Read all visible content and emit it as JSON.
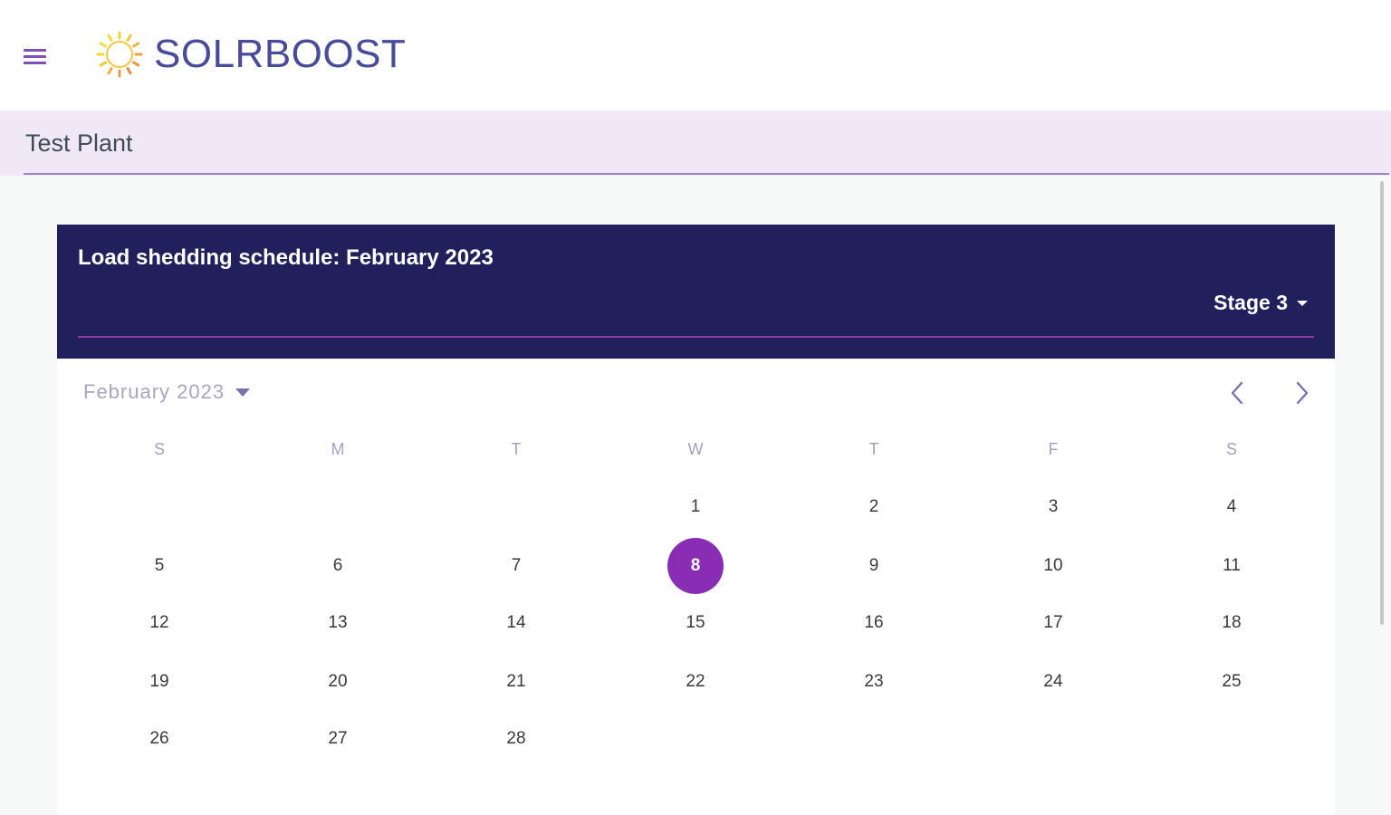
{
  "app": {
    "brand_name": "SOLRBOOST",
    "menu_icon": "hamburger-menu-icon",
    "logo_icon": "sun-ring-icon"
  },
  "plant": {
    "name": "Test Plant"
  },
  "schedule": {
    "title": "Load shedding schedule: February 2023",
    "stage_label": "Stage 3"
  },
  "calendar": {
    "month_label": "February 2023",
    "prev_icon": "chevron-left-icon",
    "next_icon": "chevron-right-icon",
    "weekdays": [
      "S",
      "M",
      "T",
      "W",
      "T",
      "F",
      "S"
    ],
    "weeks": [
      [
        "",
        "",
        "",
        "1",
        "2",
        "3",
        "4"
      ],
      [
        "5",
        "6",
        "7",
        "8",
        "9",
        "10",
        "11"
      ],
      [
        "12",
        "13",
        "14",
        "15",
        "16",
        "17",
        "18"
      ],
      [
        "19",
        "20",
        "21",
        "22",
        "23",
        "24",
        "25"
      ],
      [
        "26",
        "27",
        "28",
        "",
        "",
        "",
        ""
      ]
    ],
    "selected_day": "8"
  },
  "colors": {
    "header_bg": "#22205c",
    "accent": "#8a2db5",
    "plant_bar_bg": "#f1e8f7",
    "brand_text": "#4a4a9a"
  }
}
